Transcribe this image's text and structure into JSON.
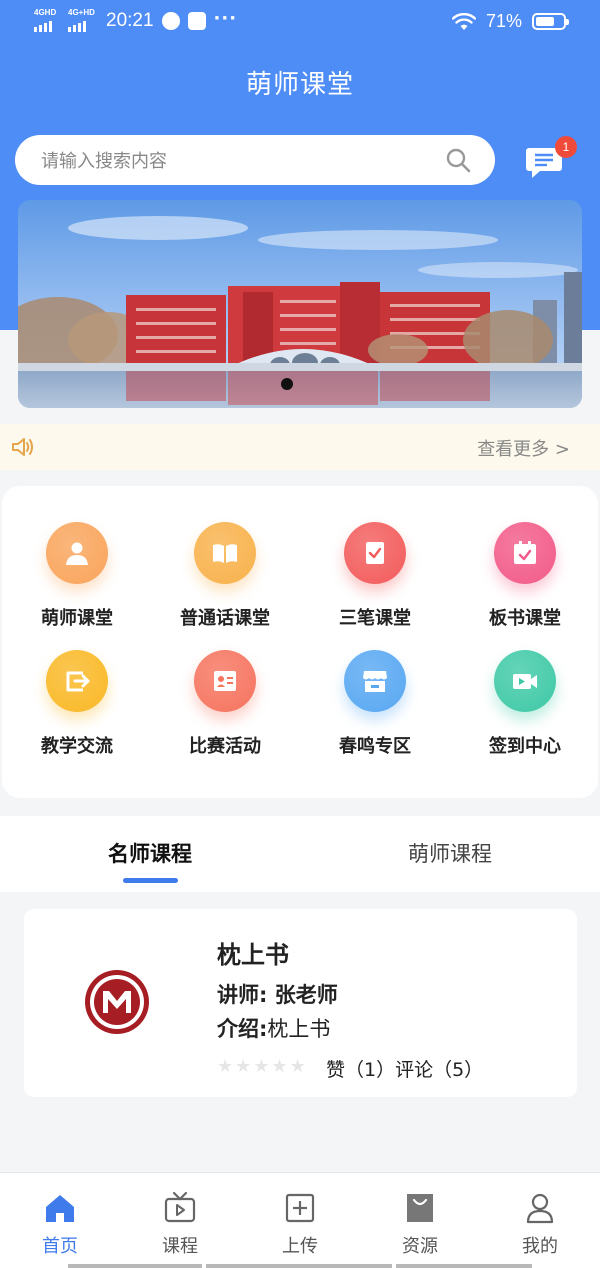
{
  "status_bar": {
    "network1": "4GHD",
    "network2": "4G+HD",
    "time": "20:21",
    "more": "···",
    "battery_percent": "71%",
    "battery_level": 0.71
  },
  "header": {
    "title": "萌师课堂"
  },
  "search": {
    "placeholder": "请输入搜索内容"
  },
  "messages": {
    "badge": "1"
  },
  "banner": {
    "slide_count": 1,
    "active_slide": 1
  },
  "notice": {
    "more_label": "查看更多 >"
  },
  "colors": {
    "brand_blue": "#4e8cf6",
    "accent_blue": "#3f7bea",
    "badge_red": "#f04a3a",
    "notice_bg": "#fdf9ec"
  },
  "features": [
    {
      "label": "萌师课堂",
      "icon": "teacher-icon",
      "color": "#f9a45a"
    },
    {
      "label": "普通话课堂",
      "icon": "book-icon",
      "color": "#f8b14a"
    },
    {
      "label": "三笔课堂",
      "icon": "checklist-icon",
      "color": "#f35b5b"
    },
    {
      "label": "板书课堂",
      "icon": "calendar-check-icon",
      "color": "#f25a88"
    },
    {
      "label": "教学交流",
      "icon": "share-icon",
      "color": "#f9b825"
    },
    {
      "label": "比赛活动",
      "icon": "id-card-icon",
      "color": "#f6735e"
    },
    {
      "label": "春鸣专区",
      "icon": "store-icon",
      "color": "#57a7f2"
    },
    {
      "label": "签到中心",
      "icon": "video-camera-icon",
      "color": "#3ec9a6"
    }
  ],
  "tabs": [
    {
      "label": "名师课程",
      "active": true
    },
    {
      "label": "萌师课程",
      "active": false
    }
  ],
  "course": {
    "title": "枕上书",
    "teacher": "讲师: 张老师",
    "intro_label": "介绍:",
    "intro_value": "枕上书",
    "rating": 0,
    "stats": "赞（1）评论（5）"
  },
  "bottom_nav": [
    {
      "label": "首页",
      "icon": "home-icon",
      "active": true
    },
    {
      "label": "课程",
      "icon": "tv-icon",
      "active": false
    },
    {
      "label": "上传",
      "icon": "upload-icon",
      "active": false
    },
    {
      "label": "资源",
      "icon": "shopping-bag-icon",
      "active": false
    },
    {
      "label": "我的",
      "icon": "profile-icon",
      "active": false
    }
  ]
}
